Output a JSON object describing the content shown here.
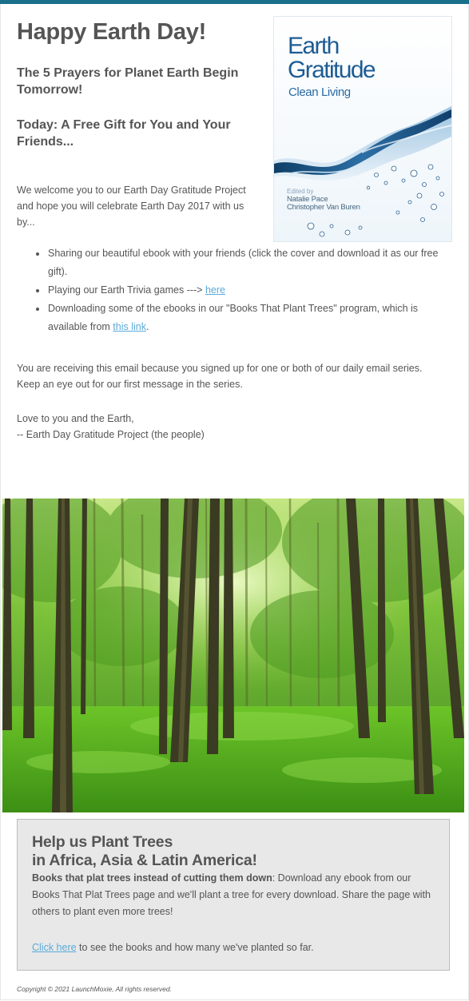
{
  "email": {
    "title": "Happy Earth Day!",
    "subtitle_1": "The 5 Prayers for Planet Earth Begin Tomorrow!",
    "subtitle_2": "Today: A Free Gift for You and Your Friends...",
    "intro": "We welcome you to our Earth Day Gratitude Project and hope you will celebrate Earth Day 2017 with us by...",
    "bullets": {
      "b1": "Sharing our beautiful ebook with your friends (click the cover and download it as our free gift).",
      "b2_pre": "Playing our Earth Trivia games ---> ",
      "b2_link": "here",
      "b3_pre": "Downloading some of the ebooks in our \"Books That Plant Trees\" program, which is available from ",
      "b3_link": "this link",
      "b3_post": "."
    },
    "para_1": "You are receiving this email because you signed up for one or both of our daily email series. Keep an eye out for our first message in the series.",
    "sign_1": "Love to you and the Earth,",
    "sign_2": "-- Earth Day Gratitude Project (the people)"
  },
  "book_cover": {
    "title_line_1": "Earth",
    "title_line_2": "Gratitude",
    "subtitle": "Clean Living",
    "edited_by": "Edited by",
    "author_1": "Natalie Pace",
    "author_2": "Christopher Van Buren"
  },
  "trees_box": {
    "heading_1": "Help us Plant Trees",
    "heading_2": "in Africa, Asia & Latin America!",
    "bold_lead": "Books that plat trees instead of cutting them down",
    "body": ": Download any ebook from our Books That Plat Trees page and we'll plant a tree for every download. Share the page with others to plant even more trees!",
    "cta_link": "Click here",
    "cta_rest": " to see the books and how many we've planted so far."
  },
  "footer": {
    "copyright": "Copyright © 2021 LaunchMoxie, All rights reserved."
  },
  "colors": {
    "top_bar": "#1a6f8a",
    "text": "#555555",
    "link": "#5aaad9",
    "box_bg": "#e8e8e8"
  }
}
